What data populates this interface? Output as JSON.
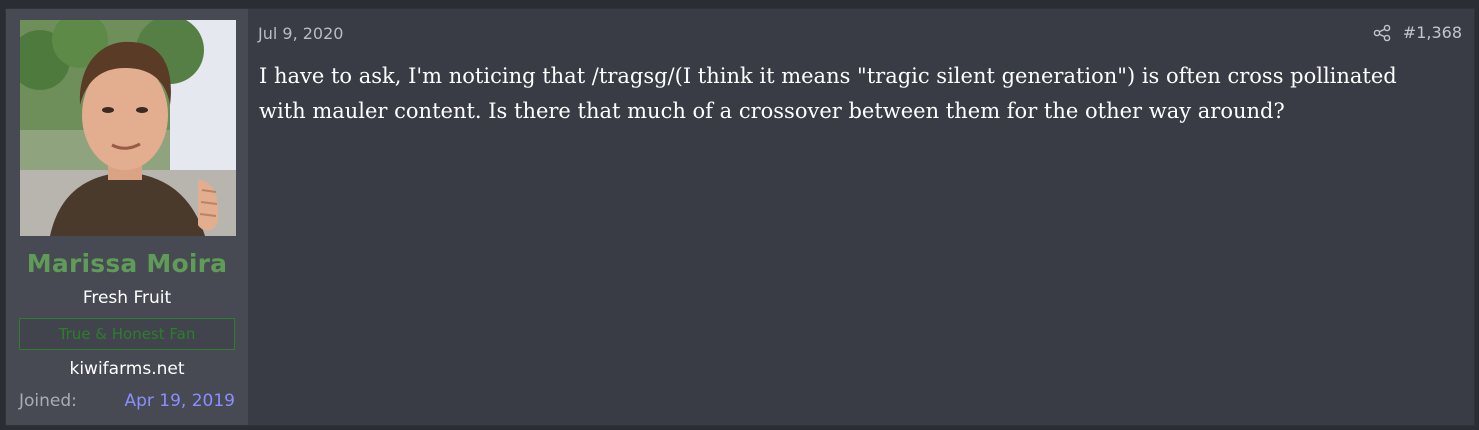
{
  "user": {
    "name": "Marissa Moira",
    "title": "Fresh Fruit",
    "banner": "True & Honest Fan",
    "site": "kiwifarms.net",
    "joined_label": "Joined:",
    "joined_date": "Apr 19, 2019"
  },
  "post": {
    "date": "Jul 9, 2020",
    "number": "#1,368",
    "share_icon": "share-icon",
    "body": "I have to ask, I'm noticing that /tragsg/(I think it means \"tragic silent generation\") is often cross pollinated with mauler content. Is there that much of a crossover between them for the other way around?"
  },
  "colors": {
    "username": "#5e9c58",
    "banner": "#2c7e2b",
    "joined_date": "#8a8fff",
    "post_bg": "#393c44",
    "user_col_bg": "#474a52"
  }
}
